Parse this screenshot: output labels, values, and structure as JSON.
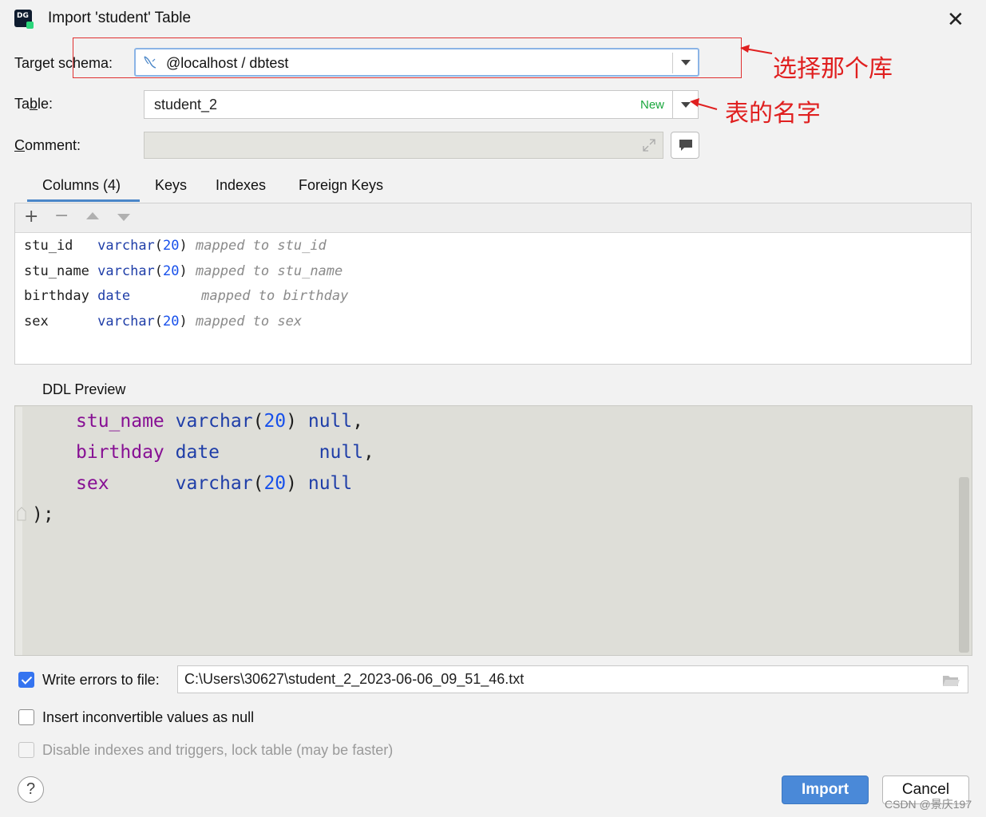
{
  "window": {
    "title": "Import 'student' Table",
    "app_icon_text": "DG"
  },
  "form": {
    "target_schema_label_pre": "Target s",
    "target_schema_label_post": "chema:",
    "target_schema_value": "@localhost / dbtest",
    "table_label_pre": "Ta",
    "table_label_u": "b",
    "table_label_post": "le:",
    "table_value": "student_2",
    "table_badge": "New",
    "comment_label_u": "C",
    "comment_label_post": "omment:",
    "comment_value": ""
  },
  "tabs": [
    {
      "label": "Columns (4)",
      "active": true
    },
    {
      "label": "Keys"
    },
    {
      "label": "Indexes"
    },
    {
      "label": "Foreign Keys"
    }
  ],
  "columns": [
    {
      "name": "stu_id  ",
      "type": "varchar",
      "open": "(",
      "size": "20",
      "close": ")",
      "mapping": "mapped to stu_id"
    },
    {
      "name": "stu_name",
      "type": "varchar",
      "open": "(",
      "size": "20",
      "close": ")",
      "mapping": "mapped to stu_name"
    },
    {
      "name": "birthday",
      "type": "date",
      "open": "",
      "size": "",
      "close": "",
      "mapping": "mapped to birthday"
    },
    {
      "name": "sex     ",
      "type": "varchar",
      "open": "(",
      "size": "20",
      "close": ")",
      "mapping": "mapped to sex"
    }
  ],
  "ddl": {
    "label": "DDL Preview",
    "lines": [
      {
        "ident": "stu_name",
        "type": "varchar",
        "open": "(",
        "size": "20",
        "close": ")",
        "nul": "null",
        "end": ","
      },
      {
        "ident": "birthday",
        "type": "date",
        "open": "",
        "size": "",
        "close": "",
        "nul": "null",
        "end": ","
      },
      {
        "ident": "sex",
        "type": "varchar",
        "open": "(",
        "size": "20",
        "close": ")",
        "nul": "null",
        "end": ""
      }
    ],
    "closing": ");"
  },
  "options": {
    "write_errors_label": "Write errors to file:",
    "write_errors_checked": true,
    "error_file_path": "C:\\Users\\30627\\student_2_2023-06-06_09_51_46.txt",
    "insert_null_label": "Insert inconvertible values as null",
    "disable_indexes_label": "Disable indexes and triggers, lock table (may be faster)"
  },
  "buttons": {
    "help": "?",
    "import": "Import",
    "cancel": "Cancel"
  },
  "annotations": {
    "schema_note": "选择那个库",
    "table_note": "表的名字"
  },
  "watermark": "CSDN @景庆197",
  "colors": {
    "accent": "#4a89d8",
    "annotation": "#e02020",
    "new_badge": "#1aa73d"
  }
}
